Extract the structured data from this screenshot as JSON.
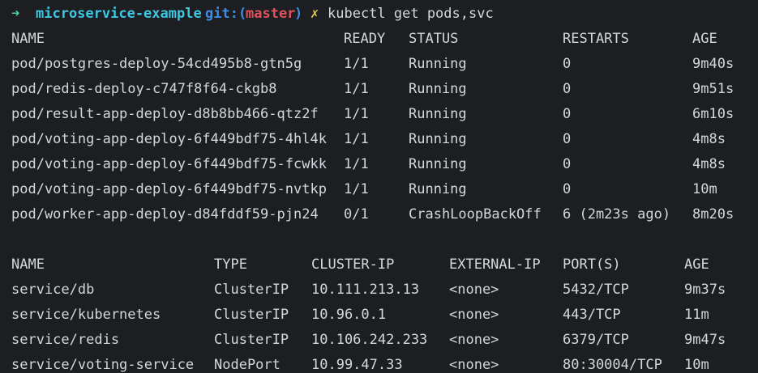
{
  "prompt": {
    "arrow": "➜",
    "dir": "microservice-example",
    "git_label": "git:(",
    "branch": "master",
    "git_close": ")",
    "dirty_mark": "✗",
    "command": "kubectl get pods,svc"
  },
  "pods": {
    "headers": [
      "NAME",
      "READY",
      "STATUS",
      "RESTARTS",
      "AGE"
    ],
    "rows": [
      [
        "pod/postgres-deploy-54cd495b8-gtn5g",
        "1/1",
        "Running",
        "0",
        "9m40s"
      ],
      [
        "pod/redis-deploy-c747f8f64-ckgb8",
        "1/1",
        "Running",
        "0",
        "9m51s"
      ],
      [
        "pod/result-app-deploy-d8b8bb466-qtz2f",
        "1/1",
        "Running",
        "0",
        "6m10s"
      ],
      [
        "pod/voting-app-deploy-6f449bdf75-4hl4k",
        "1/1",
        "Running",
        "0",
        "4m8s"
      ],
      [
        "pod/voting-app-deploy-6f449bdf75-fcwkk",
        "1/1",
        "Running",
        "0",
        "4m8s"
      ],
      [
        "pod/voting-app-deploy-6f449bdf75-nvtkp",
        "1/1",
        "Running",
        "0",
        "10m"
      ],
      [
        "pod/worker-app-deploy-d84fddf59-pjn24",
        "0/1",
        "CrashLoopBackOff",
        "6 (2m23s ago)",
        "8m20s"
      ]
    ]
  },
  "services": {
    "headers": [
      "NAME",
      "TYPE",
      "CLUSTER-IP",
      "EXTERNAL-IP",
      "PORT(S)",
      "AGE"
    ],
    "rows": [
      [
        "service/db",
        "ClusterIP",
        "10.111.213.13",
        "<none>",
        "5432/TCP",
        "9m37s"
      ],
      [
        "service/kubernetes",
        "ClusterIP",
        "10.96.0.1",
        "<none>",
        "443/TCP",
        "11m"
      ],
      [
        "service/redis",
        "ClusterIP",
        "10.106.242.233",
        "<none>",
        "6379/TCP",
        "9m47s"
      ],
      [
        "service/voting-service",
        "NodePort",
        "10.99.47.33",
        "<none>",
        "80:30004/TCP",
        "10m"
      ]
    ]
  },
  "colors": {
    "background": "#1c1e22",
    "text": "#d4d7dc",
    "arrow": "#4fd39a",
    "dir": "#3fc6e0",
    "git": "#3f8ce6",
    "branch": "#e0525b",
    "dirty": "#e6c84a"
  }
}
